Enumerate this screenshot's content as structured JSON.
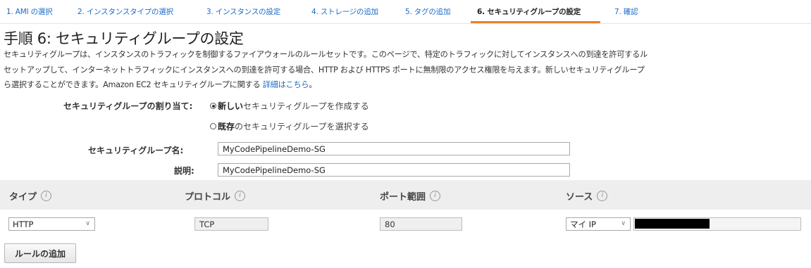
{
  "steps": [
    {
      "label": "1. AMI の選択",
      "active": false
    },
    {
      "label": "2. インスタンスタイプの選択",
      "active": false
    },
    {
      "label": "3. インスタンスの設定",
      "active": false
    },
    {
      "label": "4. ストレージの追加",
      "active": false
    },
    {
      "label": "5. タグの追加",
      "active": false
    },
    {
      "label": "6. セキュリティグループの設定",
      "active": true
    },
    {
      "label": "7. 確認",
      "active": false
    }
  ],
  "page_title": "手順 6: セキュリティグループの設定",
  "description": {
    "line1": "セキュリティグループは、インスタンスのトラフィックを制御するファイアウォールのルールセットです。このページで、特定のトラフィックに対してインスタンスへの到達を許可するル",
    "line2": "セットアップして、インターネットトラフィックにインスタンスへの到達を許可する場合、HTTP および HTTPS ポートに無制限のアクセス権限を与えます。新しいセキュリティグループ",
    "line3": "ら選択することができます。Amazon EC2 セキュリティグループに関する ",
    "link": "詳細はこちら",
    "line3_end": "。"
  },
  "assignment": {
    "label": "セキュリティグループの割り当て:",
    "option_new_bold": "新しい",
    "option_new_rest": "セキュリティグループを作成する",
    "option_existing_bold": "既存",
    "option_existing_rest": "のセキュリティグループを選択する",
    "selected": "new"
  },
  "form": {
    "name_label": "セキュリティグループ名:",
    "name_value": "MyCodePipelineDemo-SG",
    "desc_label": "説明:",
    "desc_value": "MyCodePipelineDemo-SG"
  },
  "rules_table": {
    "columns": [
      "タイプ",
      "プロトコル",
      "ポート範囲",
      "ソース"
    ],
    "info_glyph": "i",
    "rows": [
      {
        "type": "HTTP",
        "protocol": "TCP",
        "port_range": "80",
        "source": "マイ IP"
      }
    ]
  },
  "icons": {
    "chevron": "∨"
  },
  "add_rule_label": "ルールの追加",
  "colors": {
    "link": "#1b6ac9",
    "active_tab_underline": "#e9822a",
    "header_bg": "#eeeeee"
  }
}
